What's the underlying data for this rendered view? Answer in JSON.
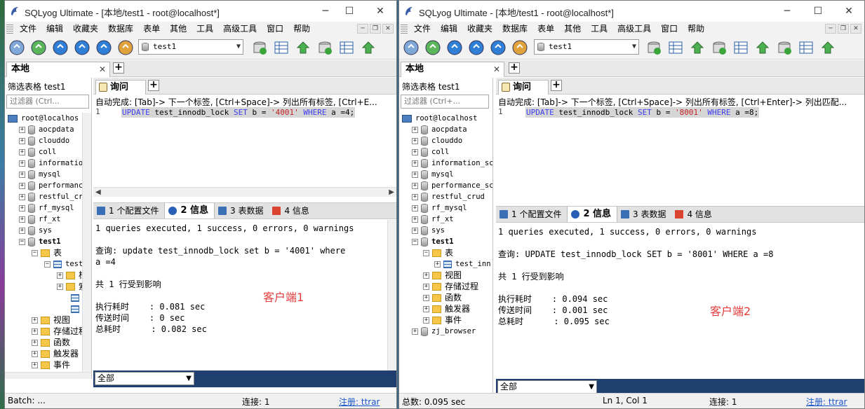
{
  "windows": [
    {
      "title": "SQLyog Ultimate - [本地/test1 - root@localhost*]",
      "menu": [
        "文件",
        "编辑",
        "收藏夹",
        "数据库",
        "表单",
        "其他",
        "工具",
        "高级工具",
        "窗口",
        "帮助"
      ],
      "database_select": "test1",
      "connection_tab": "本地",
      "object_browser": {
        "filter_label": "筛选表格 test1",
        "filter_placeholder": "过滤器 (Ctrl...",
        "tree": [
          {
            "label": "root@localhos",
            "icon": "server",
            "level": 0,
            "exp": ""
          },
          {
            "label": "aocpdata",
            "icon": "db",
            "level": 1,
            "exp": "+"
          },
          {
            "label": "clouddo",
            "icon": "db",
            "level": 1,
            "exp": "+"
          },
          {
            "label": "coll",
            "icon": "db",
            "level": 1,
            "exp": "+"
          },
          {
            "label": "informatio",
            "icon": "db",
            "level": 1,
            "exp": "+"
          },
          {
            "label": "mysql",
            "icon": "db",
            "level": 1,
            "exp": "+"
          },
          {
            "label": "performanc",
            "icon": "db",
            "level": 1,
            "exp": "+"
          },
          {
            "label": "restful_cr",
            "icon": "db",
            "level": 1,
            "exp": "+"
          },
          {
            "label": "rf_mysql",
            "icon": "db",
            "level": 1,
            "exp": "+"
          },
          {
            "label": "rf_xt",
            "icon": "db",
            "level": 1,
            "exp": "+"
          },
          {
            "label": "sys",
            "icon": "db",
            "level": 1,
            "exp": "+"
          },
          {
            "label": "test1",
            "icon": "db",
            "level": 1,
            "exp": "−",
            "bold": true
          },
          {
            "label": "表",
            "icon": "folder",
            "level": 2,
            "exp": "−",
            "cjk": true
          },
          {
            "label": "test",
            "icon": "table",
            "level": 3,
            "exp": "−"
          },
          {
            "label": "栏",
            "icon": "folder",
            "level": 4,
            "exp": "+",
            "cjk": true
          },
          {
            "label": "索",
            "icon": "folder",
            "level": 4,
            "exp": "+",
            "cjk": true
          },
          {
            "label": "",
            "icon": "table",
            "level": 5,
            "exp": ""
          },
          {
            "label": "",
            "icon": "table",
            "level": 5,
            "exp": ""
          },
          {
            "label": "视图",
            "icon": "folder",
            "level": 2,
            "exp": "+",
            "cjk": true
          },
          {
            "label": "存储过程",
            "icon": "folder",
            "level": 2,
            "exp": "+",
            "cjk": true
          },
          {
            "label": "函数",
            "icon": "folder",
            "level": 2,
            "exp": "+",
            "cjk": true
          },
          {
            "label": "触发器",
            "icon": "folder",
            "level": 2,
            "exp": "+",
            "cjk": true
          },
          {
            "label": "事件",
            "icon": "folder",
            "level": 2,
            "exp": "+",
            "cjk": true
          }
        ]
      },
      "query_tab": "询问",
      "autocomplete_hint": "自动完成: [Tab]-> 下一个标签, [Ctrl+Space]-> 列出所有标签, [Ctrl+E...",
      "editor": {
        "line": "1",
        "parts": [
          [
            "kw",
            "UPDATE"
          ],
          [
            "",
            "test_innodb_lock"
          ],
          [
            "kw",
            "SET"
          ],
          [
            "",
            "b ="
          ],
          [
            "str",
            "'4001'"
          ],
          [
            "kw",
            "WHERE"
          ],
          [
            "",
            "a =4;"
          ]
        ]
      },
      "result_tabs": [
        "1 个配置文件",
        "2 信息",
        "3 表数据",
        "4 信息"
      ],
      "messages": [
        "1 queries executed, 1 success, 0 errors, 0 warnings",
        "查询: update test_innodb_lock set b = '4001' where",
        "a =4",
        "共 1 行受到影响",
        "执行耗时    : 0.081 sec",
        "传送时间    : 0 sec",
        "总耗时      : 0.082 sec"
      ],
      "client_label": "客户端1",
      "filter_select": "全部",
      "status": {
        "left": "Batch: ...",
        "conn": "连接: 1",
        "reg": "注册: ttrar"
      }
    },
    {
      "title": "SQLyog Ultimate - [本地/test1 - root@localhost*]",
      "menu": [
        "文件",
        "编辑",
        "收藏夹",
        "数据库",
        "表单",
        "其他",
        "工具",
        "高级工具",
        "窗口",
        "帮助"
      ],
      "database_select": "test1",
      "connection_tab": "本地",
      "object_browser": {
        "filter_label": "筛选表格 test1",
        "filter_placeholder": "过滤器 (Ctrl+...",
        "tree": [
          {
            "label": "root@localhost",
            "icon": "server",
            "level": 0,
            "exp": ""
          },
          {
            "label": "aocpdata",
            "icon": "db",
            "level": 1,
            "exp": "+"
          },
          {
            "label": "clouddo",
            "icon": "db",
            "level": 1,
            "exp": "+"
          },
          {
            "label": "coll",
            "icon": "db",
            "level": 1,
            "exp": "+"
          },
          {
            "label": "information_sch",
            "icon": "db",
            "level": 1,
            "exp": "+"
          },
          {
            "label": "mysql",
            "icon": "db",
            "level": 1,
            "exp": "+"
          },
          {
            "label": "performance_sch",
            "icon": "db",
            "level": 1,
            "exp": "+"
          },
          {
            "label": "restful_crud",
            "icon": "db",
            "level": 1,
            "exp": "+"
          },
          {
            "label": "rf_mysql",
            "icon": "db",
            "level": 1,
            "exp": "+"
          },
          {
            "label": "rf_xt",
            "icon": "db",
            "level": 1,
            "exp": "+"
          },
          {
            "label": "sys",
            "icon": "db",
            "level": 1,
            "exp": "+"
          },
          {
            "label": "test1",
            "icon": "db",
            "level": 1,
            "exp": "−",
            "bold": true
          },
          {
            "label": "表",
            "icon": "folder",
            "level": 2,
            "exp": "−",
            "cjk": true
          },
          {
            "label": "test_inn",
            "icon": "table",
            "level": 3,
            "exp": "+"
          },
          {
            "label": "视图",
            "icon": "folder",
            "level": 2,
            "exp": "+",
            "cjk": true
          },
          {
            "label": "存储过程",
            "icon": "folder",
            "level": 2,
            "exp": "+",
            "cjk": true
          },
          {
            "label": "函数",
            "icon": "folder",
            "level": 2,
            "exp": "+",
            "cjk": true
          },
          {
            "label": "触发器",
            "icon": "folder",
            "level": 2,
            "exp": "+",
            "cjk": true
          },
          {
            "label": "事件",
            "icon": "folder",
            "level": 2,
            "exp": "+",
            "cjk": true
          },
          {
            "label": "zj_browser",
            "icon": "db",
            "level": 1,
            "exp": "+"
          }
        ]
      },
      "query_tab": "询问",
      "autocomplete_hint": "自动完成: [Tab]-> 下一个标签, [Ctrl+Space]-> 列出所有标签, [Ctrl+Enter]-> 列出匹配...",
      "editor": {
        "line": "1",
        "parts": [
          [
            "kw",
            "UPDATE"
          ],
          [
            "",
            "test_innodb_lock"
          ],
          [
            "kw",
            "SET"
          ],
          [
            "",
            "b ="
          ],
          [
            "str",
            "'8001'"
          ],
          [
            "kw",
            "WHERE"
          ],
          [
            "",
            "a =8;"
          ]
        ]
      },
      "result_tabs": [
        "1 个配置文件",
        "2 信息",
        "3 表数据",
        "4 信息"
      ],
      "messages": [
        "1 queries executed, 1 success, 0 errors, 0 warnings",
        "查询: UPDATE test_innodb_lock SET b = '8001' WHERE a =8",
        "共 1 行受到影响",
        "执行耗时    : 0.094 sec",
        "传送时间    : 0.001 sec",
        "总耗时      : 0.095 sec"
      ],
      "client_label": "客户端2",
      "filter_select": "全部",
      "status": {
        "left": "总数: 0.095 sec",
        "pos": "Ln 1, Col 1",
        "conn": "连接: 1",
        "reg": "注册: ttrar"
      }
    }
  ],
  "colors": {
    "keyword": "#3d3df2",
    "string": "#c21f1f",
    "client_label": "#e53b3b",
    "filter_bar": "#1f3f6e",
    "link": "#1a56c9"
  },
  "icons": [
    "sqlyog-dolphin-icon",
    "minimize-icon",
    "maximize-icon",
    "close-icon",
    "database-icon",
    "folder-icon",
    "table-icon",
    "server-icon"
  ]
}
